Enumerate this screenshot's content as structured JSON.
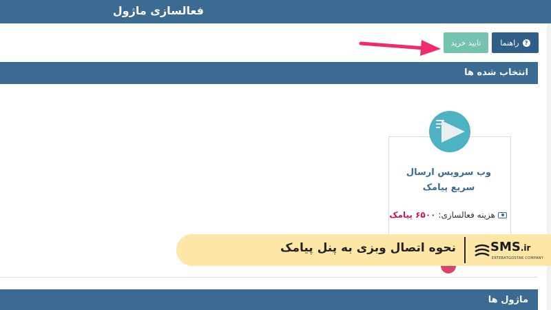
{
  "header": {
    "title": "فعالسازی ماژول"
  },
  "toolbar": {
    "help_label": "راهنما",
    "confirm_label": "تایید خرید"
  },
  "selected_panel": {
    "title": "انتخاب شده ها",
    "card": {
      "title": "وب سرویس ارسال سریع پیامک",
      "cost_label": "هزینه فعالسازی:",
      "cost_value": "۶۵۰۰ پیامک"
    }
  },
  "modules_panel": {
    "title": "ماژول ها"
  },
  "banner": {
    "text": "نحوه اتصال وبزی به پنل پیامک",
    "logo_main": "SMS",
    "logo_suffix": ".ir",
    "logo_sub": "ERTEBATGOSTAR COMPANY"
  },
  "colors": {
    "header": "#3b6a92",
    "confirm": "#74c3b0",
    "accent": "#c2185b",
    "arrow": "#ef2b6a"
  }
}
